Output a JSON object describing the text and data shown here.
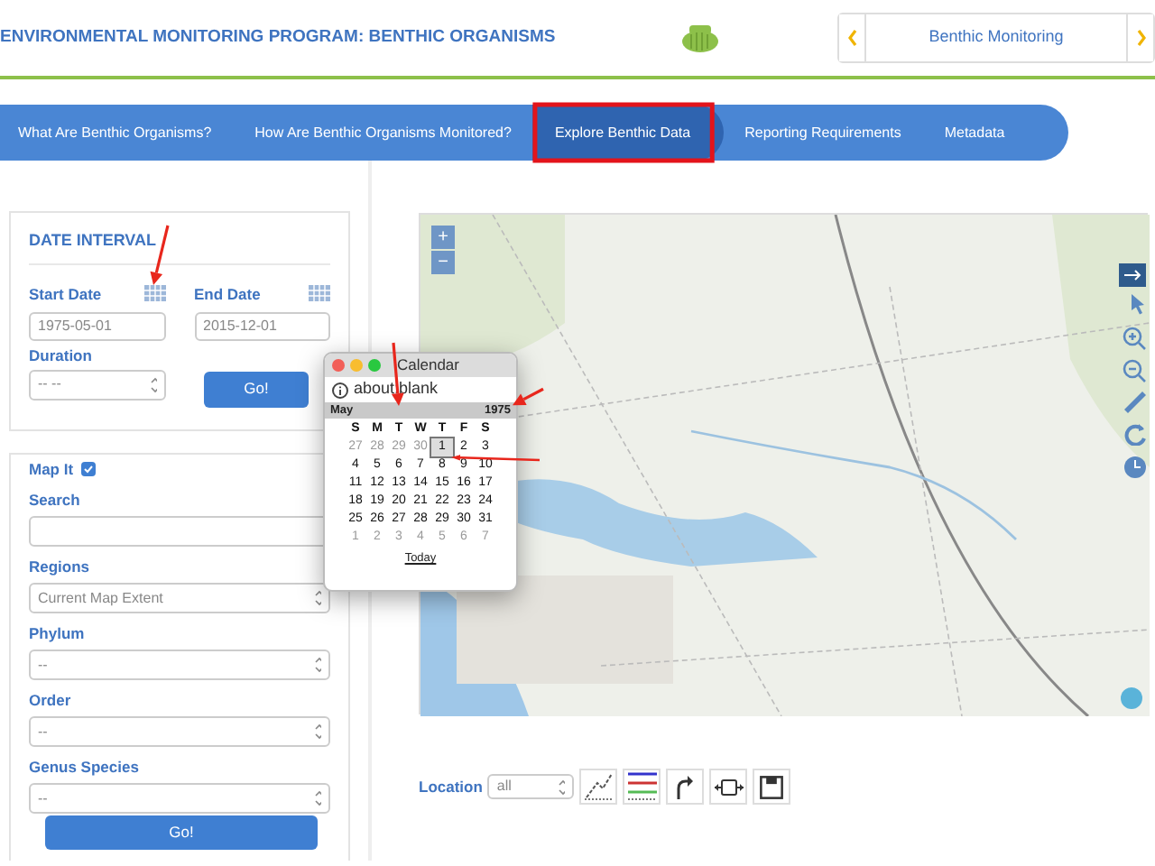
{
  "header": {
    "title": "ENVIRONMENTAL MONITORING PROGRAM: BENTHIC ORGANISMS",
    "carousel": {
      "label": "Benthic Monitoring"
    }
  },
  "nav": {
    "tabs": [
      {
        "label": "What Are Benthic Organisms?",
        "selected": false
      },
      {
        "label": "How Are Benthic Organisms Monitored?",
        "selected": false
      },
      {
        "label": "Explore Benthic Data",
        "selected": true
      },
      {
        "label": "Reporting Requirements",
        "selected": false
      },
      {
        "label": "Metadata",
        "selected": false
      }
    ]
  },
  "date_interval": {
    "title": "DATE INTERVAL",
    "start_date": {
      "label": "Start Date",
      "value": "1975-05-01"
    },
    "end_date": {
      "label": "End Date",
      "value": "2015-12-01"
    },
    "duration": {
      "label": "Duration",
      "value": "-- --"
    },
    "go_button": "Go!"
  },
  "filters": {
    "map_it": {
      "label": "Map It",
      "checked": true
    },
    "search": {
      "label": "Search"
    },
    "selects": [
      {
        "label": "Regions",
        "value": "Current Map Extent"
      },
      {
        "label": "Phylum",
        "value": "--"
      },
      {
        "label": "Order",
        "value": "--"
      },
      {
        "label": "Genus Species",
        "value": "--"
      }
    ],
    "go_button": "Go!"
  },
  "map": {
    "zoom_in": "+",
    "zoom_out": "−"
  },
  "location": {
    "label": "Location",
    "value": "all"
  },
  "calendar_popup": {
    "title": "Calendar",
    "address": "about:blank",
    "month": "May",
    "year": "1975",
    "weekdays": [
      "S",
      "M",
      "T",
      "W",
      "T",
      "F",
      "S"
    ],
    "weeks": [
      [
        {
          "day": "27",
          "muted": true,
          "selected": false
        },
        {
          "day": "28",
          "muted": true,
          "selected": false
        },
        {
          "day": "29",
          "muted": true,
          "selected": false
        },
        {
          "day": "30",
          "muted": true,
          "selected": false
        },
        {
          "day": "1",
          "muted": false,
          "selected": true
        },
        {
          "day": "2",
          "muted": false,
          "selected": false
        },
        {
          "day": "3",
          "muted": false,
          "selected": false
        }
      ],
      [
        {
          "day": "4",
          "muted": false,
          "selected": false
        },
        {
          "day": "5",
          "muted": false,
          "selected": false
        },
        {
          "day": "6",
          "muted": false,
          "selected": false
        },
        {
          "day": "7",
          "muted": false,
          "selected": false
        },
        {
          "day": "8",
          "muted": false,
          "selected": false
        },
        {
          "day": "9",
          "muted": false,
          "selected": false
        },
        {
          "day": "10",
          "muted": false,
          "selected": false
        }
      ],
      [
        {
          "day": "11",
          "muted": false,
          "selected": false
        },
        {
          "day": "12",
          "muted": false,
          "selected": false
        },
        {
          "day": "13",
          "muted": false,
          "selected": false
        },
        {
          "day": "14",
          "muted": false,
          "selected": false
        },
        {
          "day": "15",
          "muted": false,
          "selected": false
        },
        {
          "day": "16",
          "muted": false,
          "selected": false
        },
        {
          "day": "17",
          "muted": false,
          "selected": false
        }
      ],
      [
        {
          "day": "18",
          "muted": false,
          "selected": false
        },
        {
          "day": "19",
          "muted": false,
          "selected": false
        },
        {
          "day": "20",
          "muted": false,
          "selected": false
        },
        {
          "day": "21",
          "muted": false,
          "selected": false
        },
        {
          "day": "22",
          "muted": false,
          "selected": false
        },
        {
          "day": "23",
          "muted": false,
          "selected": false
        },
        {
          "day": "24",
          "muted": false,
          "selected": false
        }
      ],
      [
        {
          "day": "25",
          "muted": false,
          "selected": false
        },
        {
          "day": "26",
          "muted": false,
          "selected": false
        },
        {
          "day": "27",
          "muted": false,
          "selected": false
        },
        {
          "day": "28",
          "muted": false,
          "selected": false
        },
        {
          "day": "29",
          "muted": false,
          "selected": false
        },
        {
          "day": "30",
          "muted": false,
          "selected": false
        },
        {
          "day": "31",
          "muted": false,
          "selected": false
        }
      ],
      [
        {
          "day": "1",
          "muted": true,
          "selected": false
        },
        {
          "day": "2",
          "muted": true,
          "selected": false
        },
        {
          "day": "3",
          "muted": true,
          "selected": false
        },
        {
          "day": "4",
          "muted": true,
          "selected": false
        },
        {
          "day": "5",
          "muted": true,
          "selected": false
        },
        {
          "day": "6",
          "muted": true,
          "selected": false
        },
        {
          "day": "7",
          "muted": true,
          "selected": false
        }
      ]
    ],
    "today_link": "Today"
  }
}
